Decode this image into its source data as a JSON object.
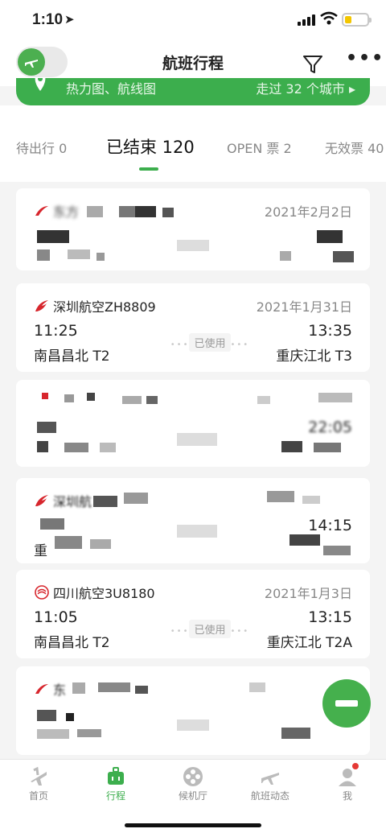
{
  "status": {
    "time": "1:10"
  },
  "header": {
    "title": "航班行程"
  },
  "banner": {
    "left": "热力图、航线图",
    "right": "走过 32 个城市 ▸"
  },
  "tabs": [
    "待出行 0",
    "已结束 120",
    "OPEN 票 2",
    "无效票 40"
  ],
  "cards": [
    {
      "airline": "东方",
      "date": "2021年2月2日"
    },
    {
      "airline": "深圳航空ZH8809",
      "date": "2021年1月31日",
      "dep_time": "11:25",
      "arr_time": "13:35",
      "dep_airport": "南昌昌北 T2",
      "arr_airport": "重庆江北 T3",
      "status": "已使用"
    },
    {
      "arr_time_partial": "22:05"
    },
    {
      "airline": "深圳航",
      "arr_time": "14:15",
      "dep_airport": "重"
    },
    {
      "airline": "四川航空3U8180",
      "date": "2021年1月3日",
      "dep_time": "11:05",
      "arr_time": "13:15",
      "dep_airport": "南昌昌北 T2",
      "arr_airport": "重庆江北 T2A",
      "status": "已使用"
    },
    {
      "airline": "东"
    }
  ],
  "nav": [
    "首页",
    "行程",
    "候机厅",
    "航班动态",
    "我"
  ],
  "colors": {
    "accent": "#3cae4d",
    "alert": "#e53935"
  }
}
